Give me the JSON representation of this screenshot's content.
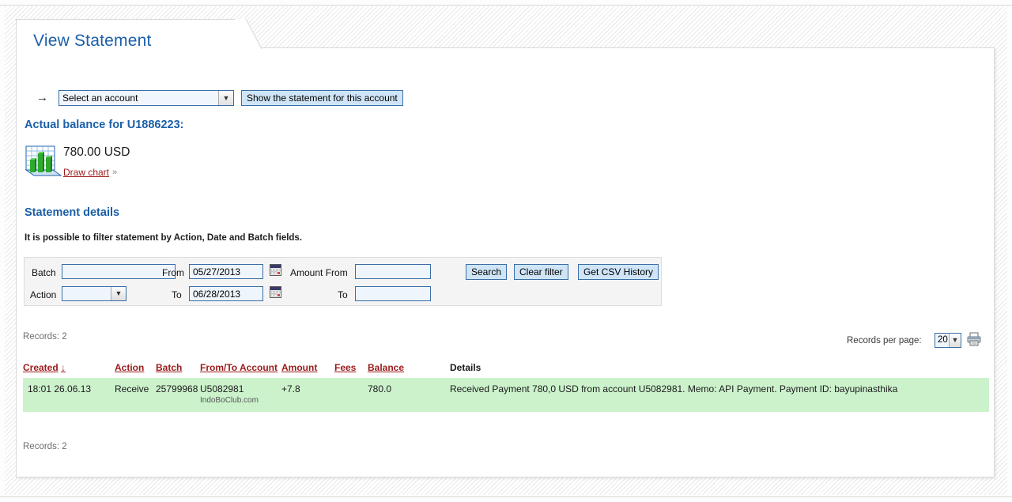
{
  "tab": {
    "title": "View Statement"
  },
  "account_selector": {
    "arrow_icon": "right-arrow-icon",
    "selected_value": "Select an account",
    "dropdown_icon": "chevron-down-icon",
    "show_button_label": "Show the statement for this account"
  },
  "balance": {
    "heading": "Actual balance for U1886223:",
    "amount": "780.00 USD",
    "draw_chart_link": "Draw chart",
    "draw_chart_arrow": "»",
    "chart_icon": "bar-chart-icon"
  },
  "statement": {
    "heading": "Statement details",
    "hint": "It is possible to filter statement by Action, Date and Batch fields."
  },
  "filters": {
    "batch_label": "Batch",
    "batch_value": "",
    "batch_placeholder": "",
    "action_label": "Action",
    "action_value": "",
    "from_label": "From",
    "from_value": "05/27/2013",
    "to_label": "To",
    "to_value": "06/28/2013",
    "amount_from_label": "Amount From",
    "amount_from_value": "",
    "amount_to_label": "To",
    "amount_to_value": "",
    "calendar_icon": "calendar-icon",
    "search_button": "Search",
    "clear_button": "Clear filter",
    "csv_button": "Get CSV History"
  },
  "pagination": {
    "records_top": "Records: 2",
    "records_bottom": "Records: 2",
    "per_page_label": "Records per page:",
    "per_page_value": "20",
    "print_icon": "printer-icon"
  },
  "table": {
    "columns": [
      {
        "label": "Created",
        "sortable": true,
        "sort_indicator": "↓"
      },
      {
        "label": "Action",
        "sortable": true
      },
      {
        "label": "Batch",
        "sortable": true
      },
      {
        "label": "From/To Account",
        "sortable": true
      },
      {
        "label": "Amount",
        "sortable": true
      },
      {
        "label": "Fees",
        "sortable": true
      },
      {
        "label": "Balance",
        "sortable": true
      },
      {
        "label": "Details",
        "sortable": false
      }
    ],
    "rows": [
      {
        "created": "18:01 26.06.13",
        "action": "Receive",
        "batch": "25799968",
        "account": "U5082981",
        "account_sub": "IndoBoClub.com",
        "amount": "+7.8",
        "fees": "",
        "balance": "780.0",
        "details": "Received Payment 780,0 USD from account U5082981. Memo: API Payment. Payment ID: bayupinasthika"
      }
    ]
  },
  "colors": {
    "heading_blue": "#1a5fa8",
    "link_red": "#9b1b1b",
    "row_green": "#ccf2cc",
    "button_blue": "#cfe5f7",
    "border_blue": "#3a6ea5"
  }
}
